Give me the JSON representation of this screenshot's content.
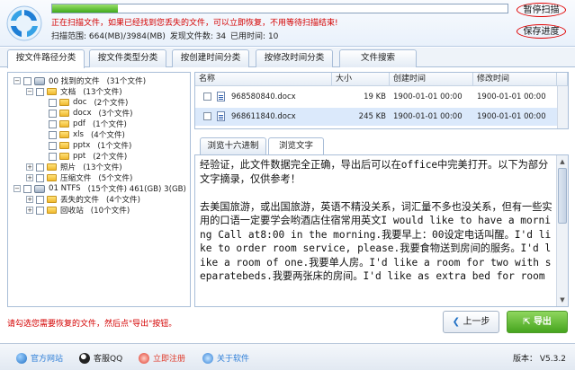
{
  "header": {
    "progress_fraction": 0.145,
    "status_message": "正在扫描文件，如果已经找到您丢失的文件，可以立即恢复，不用等待扫描结束!",
    "scan_range_label": "扫描范围: 664(MB)/3984(MB)",
    "found_files_label": "发现文件数: 34",
    "elapsed_label": "已用时间: 10",
    "pause_label": "暂停扫描",
    "save_progress_label": "保存进度"
  },
  "tabs": [
    "按文件路径分类",
    "按文件类型分类",
    "按创建时间分类",
    "按修改时间分类",
    "文件搜索"
  ],
  "tree": [
    {
      "label": "00 找到的文件",
      "count": "(31个文件)",
      "level": 0,
      "expander": "−",
      "icon": "drive"
    },
    {
      "label": "文档",
      "count": "(13个文件)",
      "level": 1,
      "expander": "−",
      "icon": "folder"
    },
    {
      "label": "doc",
      "count": "(2个文件)",
      "level": 2,
      "expander": "",
      "icon": "folder"
    },
    {
      "label": "docx",
      "count": "(3个文件)",
      "level": 2,
      "expander": "",
      "icon": "folder"
    },
    {
      "label": "pdf",
      "count": "(1个文件)",
      "level": 2,
      "expander": "",
      "icon": "folder"
    },
    {
      "label": "xls",
      "count": "(4个文件)",
      "level": 2,
      "expander": "",
      "icon": "folder"
    },
    {
      "label": "pptx",
      "count": "(1个文件)",
      "level": 2,
      "expander": "",
      "icon": "folder"
    },
    {
      "label": "ppt",
      "count": "(2个文件)",
      "level": 2,
      "expander": "",
      "icon": "folder"
    },
    {
      "label": "照片",
      "count": "(13个文件)",
      "level": 1,
      "expander": "+",
      "icon": "folder"
    },
    {
      "label": "压缩文件",
      "count": "(5个文件)",
      "level": 1,
      "expander": "+",
      "icon": "folder"
    },
    {
      "label": "01 NTFS",
      "count": "(15个文件) 461(GB) 3(GB)",
      "level": 0,
      "expander": "−",
      "icon": "drive"
    },
    {
      "label": "丢失的文件",
      "count": "(4个文件)",
      "level": 1,
      "expander": "+",
      "icon": "folder"
    },
    {
      "label": "回收站",
      "count": "(10个文件)",
      "level": 1,
      "expander": "+",
      "icon": "folder"
    }
  ],
  "file_table": {
    "columns": [
      "名称",
      "大小",
      "创建时间",
      "修改时间"
    ],
    "rows": [
      {
        "name": "968580840.docx",
        "size": "19 KB",
        "created": "1900-01-01 00:00",
        "modified": "1900-01-01 00:00",
        "selected": false
      },
      {
        "name": "968611840.docx",
        "size": "245 KB",
        "created": "1900-01-01 00:00",
        "modified": "1900-01-01 00:00",
        "selected": true
      }
    ]
  },
  "preview": {
    "tabs": [
      "浏览十六进制",
      "浏览文字"
    ],
    "text": "经验证，此文件数据完全正确，导出后可以在office中完美打开。以下为部分文字摘录，仅供参考！\n\n去美国旅游，或出国旅游，英语不精没关系，词汇量不多也没关系，但有一些实用的口语一定要学会哟酒店住宿常用英文I would like to have a morning Call at8:00 in the morning.我要早上：00设定电话叫醒。I'd like to order room service, please.我要食物送到房间的服务。I'd like a room of one.我要单人房。I'd like a room for two with separatebeds.我要两张床的房间。I'd like as extra bed for room"
  },
  "bottom": {
    "hint": "请勾选您需要恢复的文件，然后点\"导出\"按钮。",
    "prev_label": "上一步",
    "export_label": "导出"
  },
  "footer": {
    "links": [
      {
        "label": "官方网站",
        "color": "#2f7fd8"
      },
      {
        "label": "客服QQ",
        "color": "#222222"
      },
      {
        "label": "立即注册",
        "color": "#e03a2a"
      },
      {
        "label": "关于软件",
        "color": "#2f7fd8"
      }
    ],
    "version": "版本：  V5.3.2"
  }
}
